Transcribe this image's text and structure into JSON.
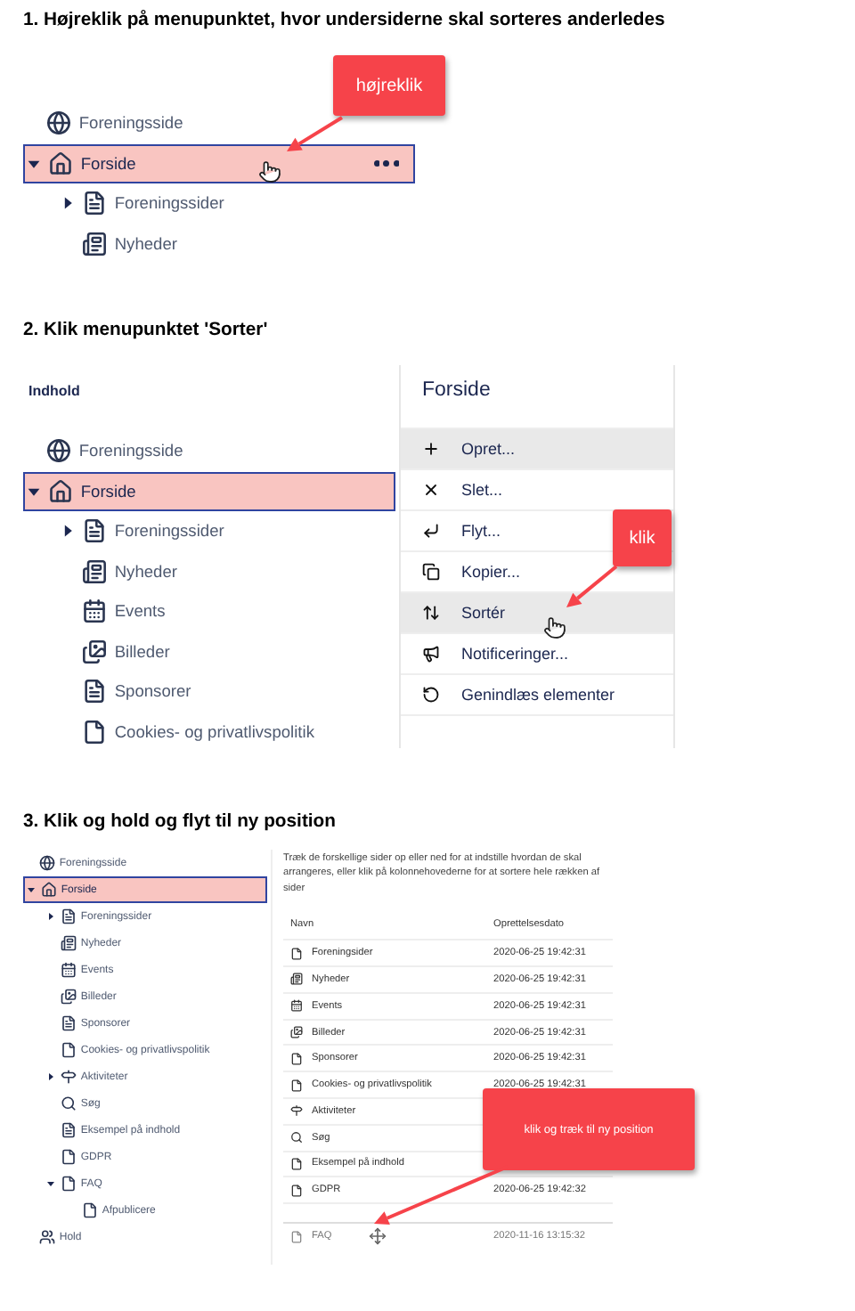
{
  "steps": [
    {
      "kind": "tree",
      "heading": "1. Højreklik på menupunktet, hvor undersiderne skal sorteres anderledes",
      "callout": "højreklik",
      "tree": [
        {
          "label": "Foreningsside",
          "kind": "globe",
          "selected": false
        },
        {
          "label": "Forside",
          "kind": "home",
          "selected": true,
          "expanded": true,
          "menu": true,
          "children": [
            {
              "label": "Foreningssider",
              "kind": "page",
              "selected": false,
              "expanded": false
            },
            {
              "label": "Nyheder",
              "kind": "news",
              "selected": false
            }
          ]
        }
      ]
    },
    {
      "kind": "menu",
      "heading": "2. Klik menupunktet 'Sorter'",
      "callout": "klik",
      "section_title": "Indhold",
      "tree": [
        {
          "label": "Foreningsside",
          "kind": "globe",
          "selected": false
        },
        {
          "label": "Forside",
          "kind": "home",
          "selected": true,
          "expanded": true,
          "children": [
            {
              "label": "Foreningssider",
              "kind": "page",
              "selected": false,
              "expanded": false
            },
            {
              "label": "Nyheder",
              "kind": "news",
              "selected": false
            },
            {
              "label": "Events",
              "kind": "calendar",
              "selected": false
            },
            {
              "label": "Billeder",
              "kind": "images",
              "selected": false
            },
            {
              "label": "Sponsorer",
              "kind": "page",
              "selected": false
            },
            {
              "label": "Cookies- og privatlivspolitik",
              "kind": "doc",
              "selected": false
            }
          ]
        }
      ],
      "menu_title": "Forside",
      "menu": [
        {
          "label": "Opret...",
          "kind": "plus",
          "highlighted": true
        },
        {
          "label": "Slet...",
          "kind": "delete",
          "highlighted": false
        },
        {
          "label": "Flyt...",
          "kind": "move",
          "highlighted": false
        },
        {
          "label": "Kopier...",
          "kind": "copy",
          "highlighted": false
        },
        {
          "label": "Sortér",
          "kind": "sort",
          "highlighted": true
        },
        {
          "label": "Notificeringer...",
          "kind": "notify",
          "highlighted": false
        },
        {
          "label": "Genindlæs elementer",
          "kind": "reload",
          "highlighted": false
        }
      ]
    },
    {
      "kind": "sort",
      "heading": "3. Klik og hold og flyt til ny position",
      "callout": "klik og træk til ny position",
      "tree": [
        {
          "label": "Foreningsside",
          "kind": "globe",
          "selected": false
        },
        {
          "label": "Forside",
          "kind": "home",
          "selected": true,
          "expanded": true,
          "children": [
            {
              "label": "Foreningssider",
              "kind": "page",
              "selected": false,
              "expanded": false
            },
            {
              "label": "Nyheder",
              "kind": "news",
              "selected": false
            },
            {
              "label": "Events",
              "kind": "calendar",
              "selected": false
            },
            {
              "label": "Billeder",
              "kind": "images",
              "selected": false
            },
            {
              "label": "Sponsorer",
              "kind": "page",
              "selected": false
            },
            {
              "label": "Cookies- og privatlivspolitik",
              "kind": "doc",
              "selected": false
            },
            {
              "label": "Aktiviteter",
              "kind": "signpost",
              "selected": false,
              "expanded": false
            },
            {
              "label": "Søg",
              "kind": "search",
              "selected": false
            },
            {
              "label": "Eksempel på indhold",
              "kind": "page",
              "selected": false
            },
            {
              "label": "GDPR",
              "kind": "doc",
              "selected": false
            },
            {
              "label": "FAQ",
              "kind": "doc",
              "selected": false,
              "expanded": true,
              "children": [
                {
                  "label": "Afpublicere",
                  "kind": "doc",
                  "selected": false
                }
              ]
            }
          ]
        },
        {
          "label": "Hold",
          "kind": "team",
          "selected": false
        }
      ],
      "description": "Træk de forskellige sider op eller ned for at indstille hvordan de skal arrangeres, eller klik på kolonnehovederne for at sortere hele rækken af sider",
      "columns": [
        "Navn",
        "Oprettelsesdato"
      ],
      "rows": [
        {
          "name": "Foreningsider",
          "kind": "doc",
          "date": "2020-06-25 19:42:31",
          "dragging": false
        },
        {
          "name": "Nyheder",
          "kind": "news",
          "date": "2020-06-25 19:42:31",
          "dragging": false
        },
        {
          "name": "Events",
          "kind": "calendar",
          "date": "2020-06-25 19:42:31",
          "dragging": false
        },
        {
          "name": "Billeder",
          "kind": "images",
          "date": "2020-06-25 19:42:31",
          "dragging": false
        },
        {
          "name": "Sponsorer",
          "kind": "doc",
          "date": "2020-06-25 19:42:31",
          "dragging": false
        },
        {
          "name": "Cookies- og privatlivspolitik",
          "kind": "doc",
          "date": "2020-06-25 19:42:31",
          "dragging": false
        },
        {
          "name": "Aktiviteter",
          "kind": "signpost",
          "dragging": false
        },
        {
          "name": "Søg",
          "kind": "search",
          "dragging": false
        },
        {
          "name": "Eksempel på indhold",
          "kind": "doc",
          "dragging": false
        },
        {
          "name": "GDPR",
          "kind": "doc",
          "date": "2020-06-25 19:42:32",
          "dragging": false
        },
        {
          "name": "FAQ",
          "kind": "doc",
          "date": "2020-11-16 13:15:32",
          "dragging": true
        }
      ]
    }
  ]
}
